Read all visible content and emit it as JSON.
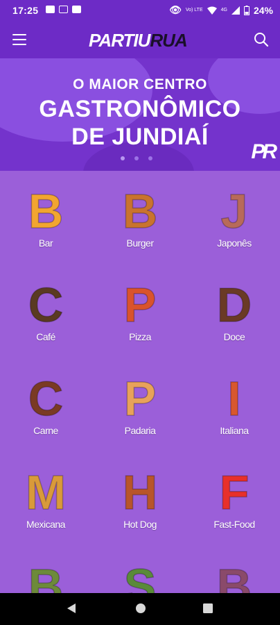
{
  "status_bar": {
    "time": "17:25",
    "battery": "24%",
    "volte": "Vo) LTE",
    "network": "4G"
  },
  "app_bar": {
    "logo_primary": "PARTIU",
    "logo_secondary": "RUA"
  },
  "banner": {
    "line1": "O MAIOR CENTRO",
    "line2": "GASTRONÔMICO",
    "line3": "DE JUNDIAÍ",
    "badge": "PR",
    "active_slide": 1,
    "slide_count": 3
  },
  "categories": [
    {
      "label": "Bar",
      "letter": "B",
      "color": "#f2a530",
      "icon": "beer-letter-b-icon"
    },
    {
      "label": "Burger",
      "letter": "B",
      "color": "#c9732e",
      "icon": "burger-letter-b-icon"
    },
    {
      "label": "Japonês",
      "letter": "J",
      "color": "#b86a5a",
      "icon": "sushi-letter-j-icon"
    },
    {
      "label": "Café",
      "letter": "C",
      "color": "#5a3a22",
      "icon": "coffee-letter-c-icon"
    },
    {
      "label": "Pizza",
      "letter": "P",
      "color": "#d9532c",
      "icon": "pizza-letter-p-icon"
    },
    {
      "label": "Doce",
      "letter": "D",
      "color": "#6a3a26",
      "icon": "donut-letter-d-icon"
    },
    {
      "label": "Carne",
      "letter": "C",
      "color": "#7a3a24",
      "icon": "meat-letter-c-icon"
    },
    {
      "label": "Padaria",
      "letter": "P",
      "color": "#e8a25a",
      "icon": "bread-letter-p-icon"
    },
    {
      "label": "Italiana",
      "letter": "I",
      "color": "#d8572e",
      "icon": "italian-letter-i-icon"
    },
    {
      "label": "Mexicana",
      "letter": "M",
      "color": "#d99a3a",
      "icon": "taco-letter-m-icon"
    },
    {
      "label": "Hot Dog",
      "letter": "H",
      "color": "#b8552a",
      "icon": "hotdog-letter-h-icon"
    },
    {
      "label": "Fast-Food",
      "letter": "F",
      "color": "#e8302a",
      "icon": "fries-letter-f-icon"
    },
    {
      "label": "",
      "letter": "B",
      "color": "#6d8a3a",
      "icon": "food-letter-b-icon"
    },
    {
      "label": "",
      "letter": "S",
      "color": "#5a8a3a",
      "icon": "salad-letter-s-icon"
    },
    {
      "label": "",
      "letter": "B",
      "color": "#8a4a6a",
      "icon": "food-letter-b2-icon"
    }
  ],
  "nav_bar": {
    "back": "back-icon",
    "home": "home-icon",
    "recents": "recents-icon"
  }
}
